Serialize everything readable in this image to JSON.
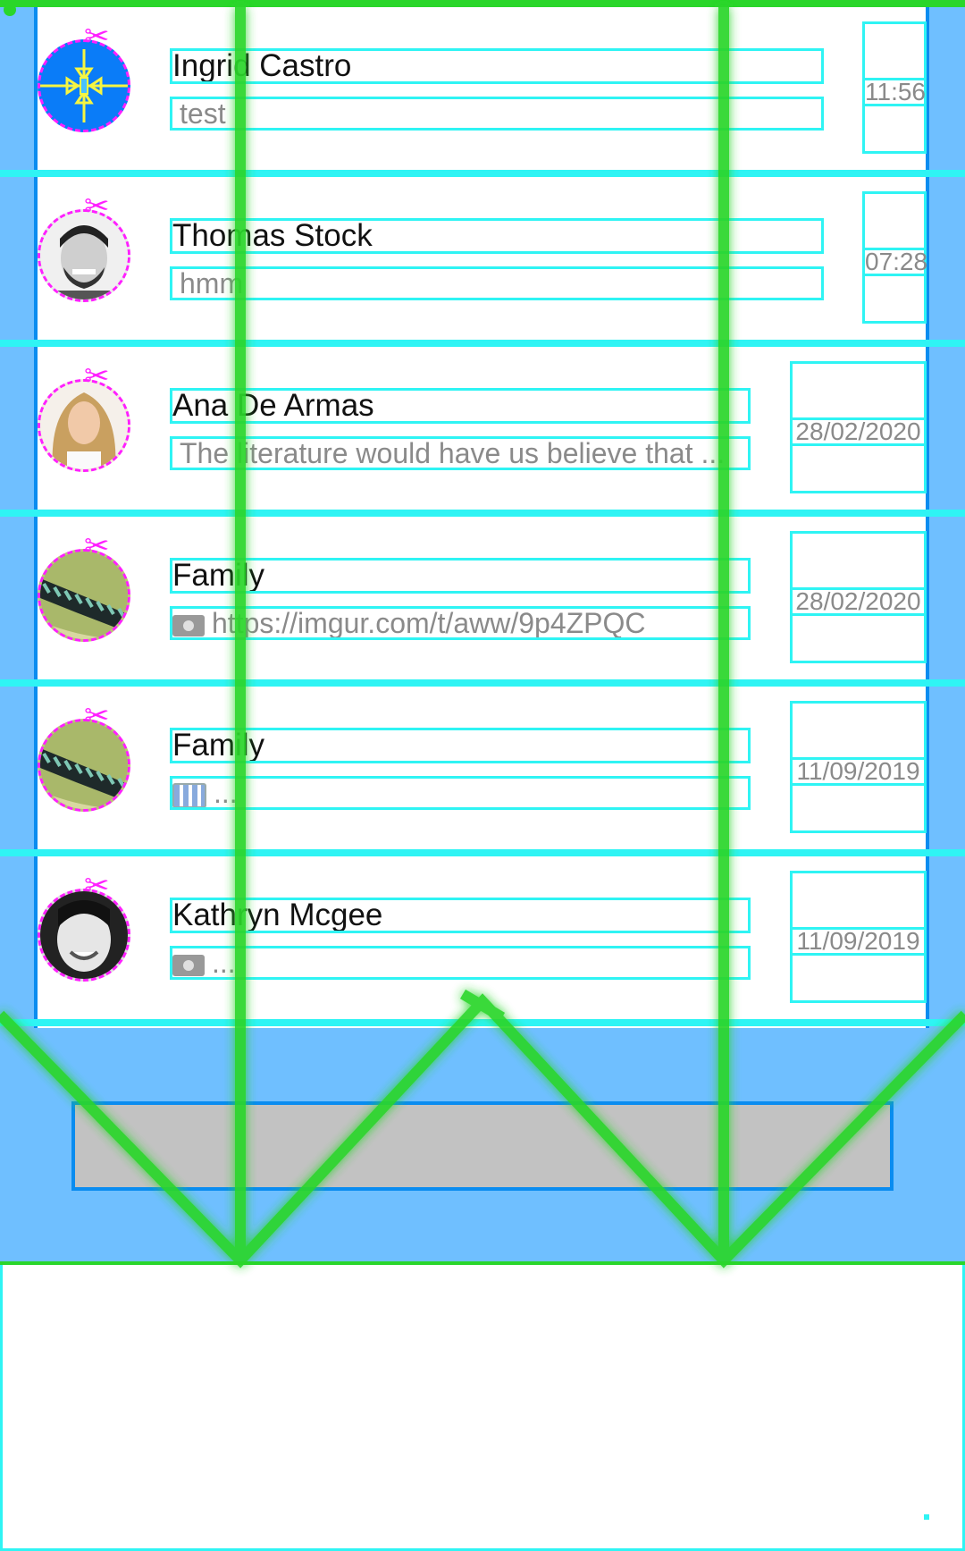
{
  "conversations": [
    {
      "name": "Ingrid Castro",
      "message": "test",
      "time": "11:56",
      "avatar": "compress-icon",
      "msg_icon": ""
    },
    {
      "name": "Thomas Stock",
      "message": "hmm",
      "time": "07:28",
      "avatar": "man-photo",
      "msg_icon": ""
    },
    {
      "name": "Ana De Armas",
      "message": "The literature would have us believe that ...",
      "time": "28/02/2020",
      "avatar": "woman-photo",
      "msg_icon": ""
    },
    {
      "name": "Family",
      "message": "https://imgur.com/t/aww/9p4ZPQC",
      "time": "28/02/2020",
      "avatar": "caterpillar-photo",
      "msg_icon": "camera-icon"
    },
    {
      "name": "Family",
      "message": "...",
      "time": "11/09/2019",
      "avatar": "caterpillar-photo",
      "msg_icon": "clapperboard-icon"
    },
    {
      "name": "Kathryn Mcgee",
      "message": "...",
      "time": "11/09/2019",
      "avatar": "woman-bw-photo",
      "msg_icon": "camera-icon"
    }
  ],
  "colors": {
    "accent_blue": "#0a8cf0",
    "list_bg": "#6fbfff",
    "outline_cyan": "#2ff4f4",
    "overlay_green": "#2ad62a",
    "dash_magenta": "#ff1fff"
  }
}
